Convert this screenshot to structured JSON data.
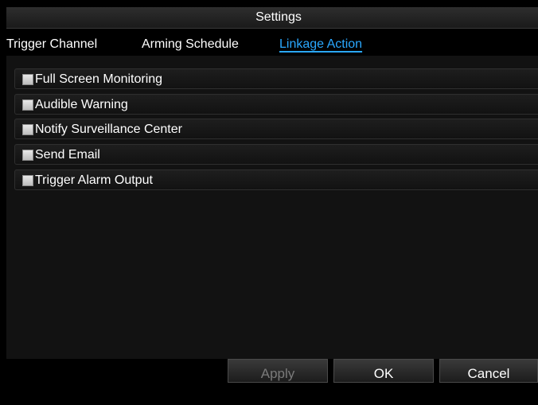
{
  "window": {
    "title": "Settings"
  },
  "tabs": [
    {
      "label": "Trigger Channel",
      "active": false
    },
    {
      "label": "Arming Schedule",
      "active": false
    },
    {
      "label": "Linkage Action",
      "active": true
    }
  ],
  "linkage_actions": [
    {
      "label": "Full Screen Monitoring",
      "checked": false
    },
    {
      "label": "Audible Warning",
      "checked": false
    },
    {
      "label": "Notify Surveillance Center",
      "checked": false
    },
    {
      "label": "Send Email",
      "checked": false
    },
    {
      "label": "Trigger Alarm Output",
      "checked": false
    }
  ],
  "buttons": {
    "apply": "Apply",
    "ok": "OK",
    "cancel": "Cancel"
  },
  "colors": {
    "active_tab": "#2aa8ff",
    "background": "#000000"
  }
}
